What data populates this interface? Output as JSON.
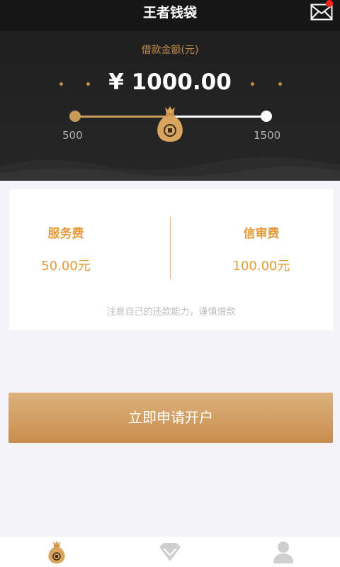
{
  "app": {
    "title": "王者钱袋"
  },
  "header": {
    "amount_label": "借款金额(元)",
    "amount_value": "¥ 1000.00",
    "slider": {
      "min_label": "500",
      "max_label": "1500",
      "min": 500,
      "max": 1500,
      "value": 1000
    },
    "has_unread_message": true
  },
  "fees": {
    "service": {
      "title": "服务费",
      "value": "50.00元"
    },
    "review": {
      "title": "信审费",
      "value": "100.00元"
    },
    "note": "注意自己的还款能力，谨慎借款"
  },
  "apply_button": {
    "label": "立即申请开户"
  },
  "tabs": [
    {
      "icon": "money-bag-icon",
      "active": true
    },
    {
      "icon": "diamond-icon",
      "active": false
    },
    {
      "icon": "user-icon",
      "active": false
    }
  ],
  "colors": {
    "accent": "#c28d4a",
    "fee_text": "#e59b3a",
    "header_bg": "#1e1e1e",
    "page_bg": "#f4f3f9",
    "notification": "#ff1f1f"
  }
}
